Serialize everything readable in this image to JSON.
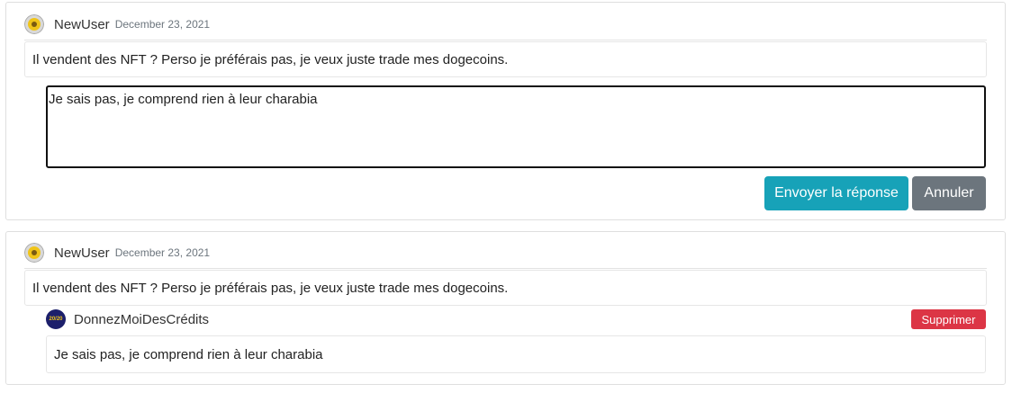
{
  "posts": [
    {
      "author": "NewUser",
      "date": "December 23, 2021",
      "message": "Il vendent des NFT ? Perso je préférais pas, je veux juste trade mes dogecoins.",
      "reply_draft": "Je sais pas, je comprend rien à leur charabia",
      "send_label": "Envoyer la réponse",
      "cancel_label": "Annuler"
    },
    {
      "author": "NewUser",
      "date": "December 23, 2021",
      "message": "Il vendent des NFT ? Perso je préférais pas, je veux juste trade mes dogecoins.",
      "reply": {
        "author": "DonnezMoiDesCrédits",
        "message": "Je sais pas, je comprend rien à leur charabia",
        "delete_label": "Supprimer",
        "avatar_text": "20/20"
      }
    }
  ],
  "colors": {
    "send": "#17a2b8",
    "cancel": "#6c757d",
    "delete": "#dc3545"
  }
}
